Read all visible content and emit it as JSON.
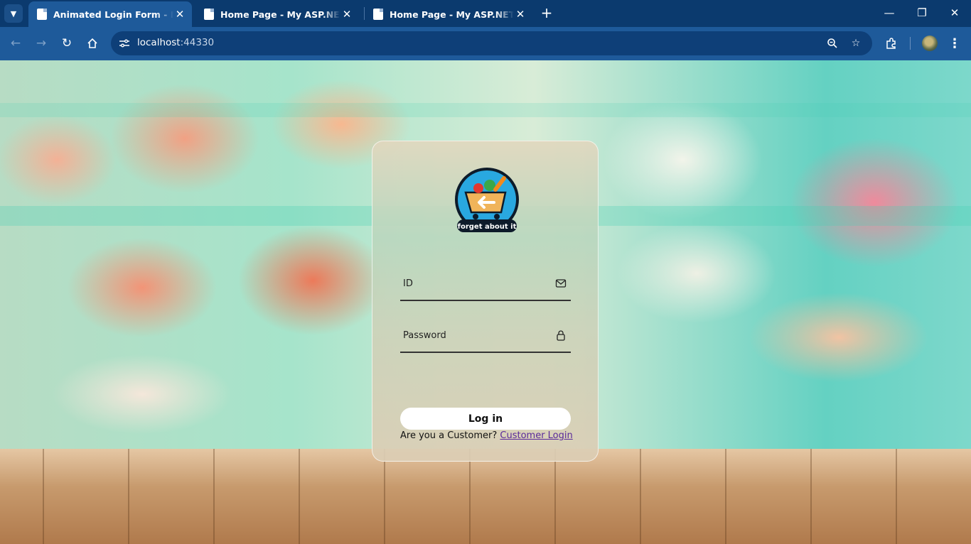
{
  "browser": {
    "tabs": [
      {
        "title": "Animated Login Form - Nothing",
        "active": true
      },
      {
        "title": "Home Page - My ASP.NET Application",
        "active": false
      },
      {
        "title": "Home Page - My ASP.NET Application",
        "active": false
      }
    ],
    "url_host": "localhost",
    "url_port": ":44330",
    "colors": {
      "frame": "#0b3a6e",
      "toolbar": "#1e5a9a",
      "omnibox": "#0e3f78"
    }
  },
  "logo": {
    "tagline": "forget about it"
  },
  "form": {
    "id_label": "ID",
    "password_label": "Password",
    "login_label": "Log in",
    "customer_prompt": "Are you a Customer?",
    "customer_link": "Customer Login"
  }
}
